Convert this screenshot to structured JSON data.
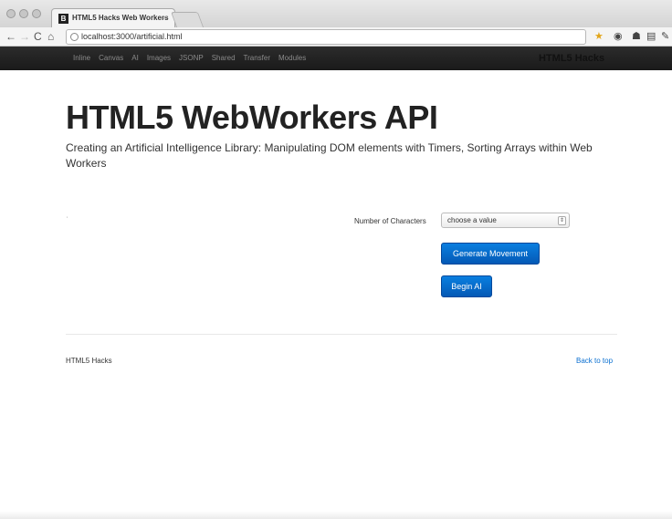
{
  "browser": {
    "tab_title": "HTML5 Hacks Web Workers",
    "tab_favicon": "B",
    "tab_close": "×",
    "url": "localhost:3000/artificial.html",
    "icons": [
      "back-arrow-icon",
      "forward-arrow-icon",
      "reload-icon",
      "home-icon",
      "star-icon",
      "extension-icon",
      "extension-icon",
      "extension-icon",
      "wrench-icon"
    ]
  },
  "navbar": {
    "links": [
      "Inline",
      "Canvas",
      "AI",
      "Images",
      "JSONP",
      "Shared",
      "Transfer",
      "Modules"
    ],
    "brand": "HTML5 Hacks"
  },
  "main": {
    "title": "HTML5 WebWorkers API",
    "subtitle": "Creating an Artificial Intelligence Library: Manipulating DOM elements with Timers, Sorting Arrays within Web Workers",
    "tiny_mark": "'",
    "field_label": "Number of Characters",
    "select_value": "choose a value",
    "generate_button": "Generate Movement",
    "begin_button": "Begin AI"
  },
  "footer": {
    "left": "HTML5 Hacks",
    "right": "Back to top"
  },
  "colors": {
    "navbar_bg": "#1f1f1f",
    "button_blue": "#0a6fd0",
    "link_blue": "#0a6fd0"
  }
}
